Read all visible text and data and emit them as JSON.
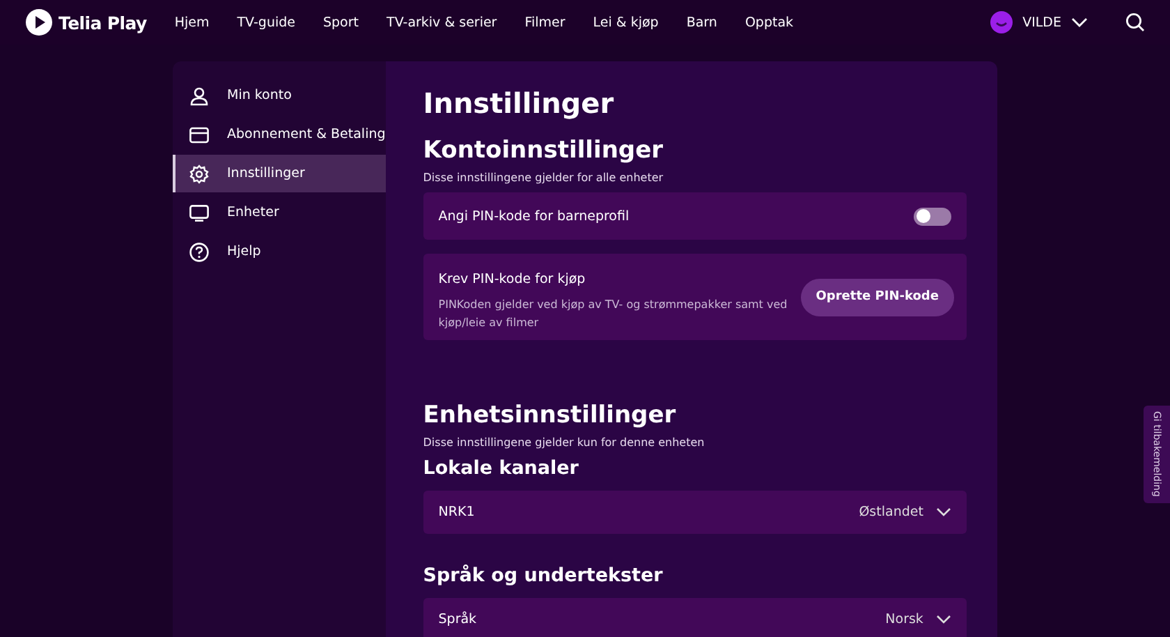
{
  "header": {
    "logo": "Telia Play",
    "nav": [
      "Hjem",
      "TV-guide",
      "Sport",
      "TV-arkiv & serier",
      "Filmer",
      "Lei & kjøp",
      "Barn",
      "Opptak"
    ],
    "user": "VILDE"
  },
  "sidebar": {
    "items": [
      {
        "label": "Min konto",
        "kind": "user",
        "selected": false
      },
      {
        "label": "Abonnement & Betaling",
        "kind": "card",
        "selected": false
      },
      {
        "label": "Innstillinger",
        "kind": "gear",
        "selected": true
      },
      {
        "label": "Enheter",
        "kind": "tv",
        "selected": false
      },
      {
        "label": "Hjelp",
        "kind": "help",
        "selected": false
      }
    ]
  },
  "main": {
    "title": "Innstillinger",
    "sections": [
      {
        "title": "Kontoinnstillinger",
        "subtitle": "Disse innstillingene gjelder for alle enheter",
        "items": [
          {
            "kind": "toggle",
            "label": "Angi PIN-kode for barneprofil",
            "on": false
          },
          {
            "kind": "action",
            "label": "Krev PIN-kode for kjøp",
            "description": "PINKoden gjelder ved kjøp av TV- og strømmepakker samt ved kjøp/leie av filmer",
            "button": "Oprette PIN-kode"
          }
        ]
      },
      {
        "title": "Enhetsinnstillinger",
        "subtitle": "Disse innstillingene gjelder kun for denne enheten",
        "items": [
          {
            "kind": "heading",
            "label": "Lokale kanaler"
          },
          {
            "kind": "select",
            "label": "NRK1",
            "value": "Østlandet"
          },
          {
            "kind": "heading",
            "label": "Språk og undertekster"
          },
          {
            "kind": "select",
            "label": "Språk",
            "value": "Norsk"
          }
        ]
      }
    ]
  },
  "feedback": "Gi tilbakemelding"
}
